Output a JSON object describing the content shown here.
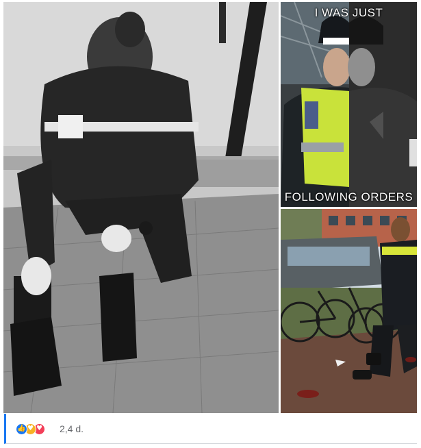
{
  "post": {
    "images": [
      {
        "name": "kneeling-officer-photo"
      },
      {
        "name": "meme-photo",
        "caption_top": "I WAS JUST",
        "caption_bottom": "FOLLOWING ORDERS"
      },
      {
        "name": "street-arrest-photo"
      }
    ],
    "reactions": {
      "icons": [
        "like-icon",
        "care-icon",
        "love-icon"
      ],
      "count_text": "2,4 d."
    }
  },
  "colors": {
    "accent": "#1877f2",
    "like": "#1877f2",
    "care": "#f7b125",
    "love": "#f33e58",
    "muted_text": "#65676b"
  }
}
